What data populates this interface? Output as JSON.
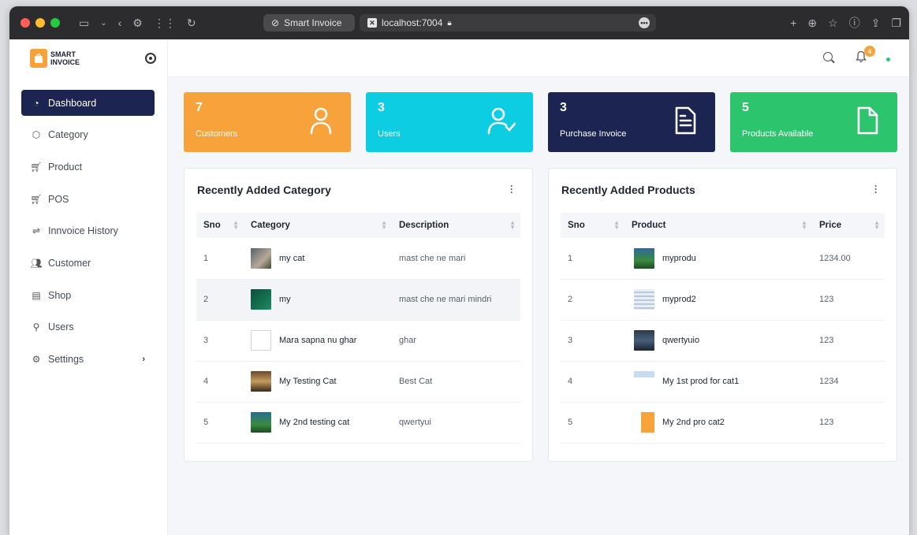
{
  "browser": {
    "tab_title": "Smart Invoice",
    "url": "localhost:7004"
  },
  "brand": {
    "line1": "SMART",
    "line2": "INVOICE"
  },
  "nav": [
    {
      "label": "Dashboard",
      "icon": "dashboard-icon",
      "active": true
    },
    {
      "label": "Category",
      "icon": "box-icon"
    },
    {
      "label": "Product",
      "icon": "cart-icon"
    },
    {
      "label": "POS",
      "icon": "cart-icon"
    },
    {
      "label": "Innvoice History",
      "icon": "arrows-icon"
    },
    {
      "label": "Customer",
      "icon": "people-icon"
    },
    {
      "label": "Shop",
      "icon": "shop-icon"
    },
    {
      "label": "Users",
      "icon": "user-icon"
    },
    {
      "label": "Settings",
      "icon": "gear-icon"
    }
  ],
  "notifications": {
    "count": "4"
  },
  "stats": [
    {
      "value": "7",
      "label": "Customers",
      "color": "#f7a23a",
      "icon": "user-icon"
    },
    {
      "value": "3",
      "label": "Users",
      "color": "#0dcde3",
      "icon": "user-check-icon"
    },
    {
      "value": "3",
      "label": "Purchase Invoice",
      "color": "#1c2551",
      "icon": "document-icon"
    },
    {
      "value": "5",
      "label": "Products Available",
      "color": "#2dc46e",
      "icon": "file-icon"
    }
  ],
  "category_table": {
    "title": "Recently Added Category",
    "columns": [
      "Sno",
      "Category",
      "Description"
    ],
    "rows": [
      {
        "sno": "1",
        "name": "my cat",
        "desc": "mast che ne mari"
      },
      {
        "sno": "2",
        "name": "my",
        "desc": "mast che ne mari mindri"
      },
      {
        "sno": "3",
        "name": "Mara sapna nu ghar",
        "desc": "ghar"
      },
      {
        "sno": "4",
        "name": "My Testing Cat",
        "desc": "Best Cat"
      },
      {
        "sno": "5",
        "name": "My 2nd testing cat",
        "desc": "qwertyui"
      }
    ]
  },
  "product_table": {
    "title": "Recently Added Products",
    "columns": [
      "Sno",
      "Product",
      "Price"
    ],
    "rows": [
      {
        "sno": "1",
        "name": "myprodu",
        "price": "1234.00"
      },
      {
        "sno": "2",
        "name": "myprod2",
        "price": "123"
      },
      {
        "sno": "3",
        "name": "qwertyuio",
        "price": "123"
      },
      {
        "sno": "4",
        "name": "My 1st prod for cat1",
        "price": "1234"
      },
      {
        "sno": "5",
        "name": "My 2nd pro cat2",
        "price": "123"
      }
    ]
  }
}
